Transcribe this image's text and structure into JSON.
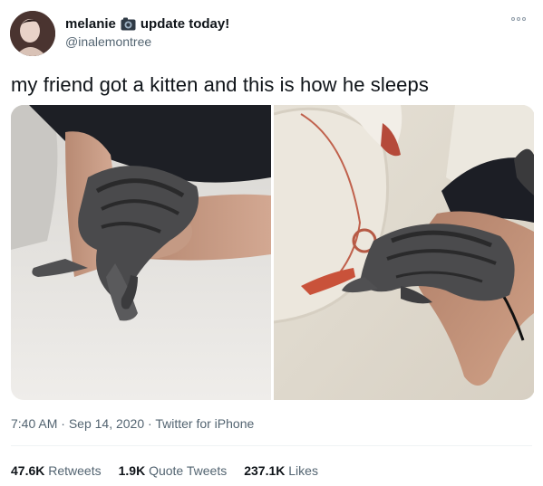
{
  "header": {
    "display_name": "melanie",
    "name_suffix": "update today!",
    "handle": "@inalemontree",
    "name_icon": "camera-icon",
    "more_icon": "more-options-icon"
  },
  "tweet": {
    "text": "my friend got a kitten and this is how he sleeps"
  },
  "media": {
    "photos": [
      {
        "subject": "kitten sleeping on arm"
      },
      {
        "subject": "kitten sleeping on arm next to pillow"
      }
    ]
  },
  "meta": {
    "time": "7:40 AM",
    "date": "Sep 14, 2020",
    "source": "Twitter for iPhone",
    "separator": "·"
  },
  "stats": {
    "retweets_count": "47.6K",
    "retweets_label": "Retweets",
    "quotes_count": "1.9K",
    "quotes_label": "Quote Tweets",
    "likes_count": "237.1K",
    "likes_label": "Likes"
  },
  "colors": {
    "text_primary": "#0f1419",
    "text_secondary": "#536471",
    "divider": "#eff3f4"
  }
}
